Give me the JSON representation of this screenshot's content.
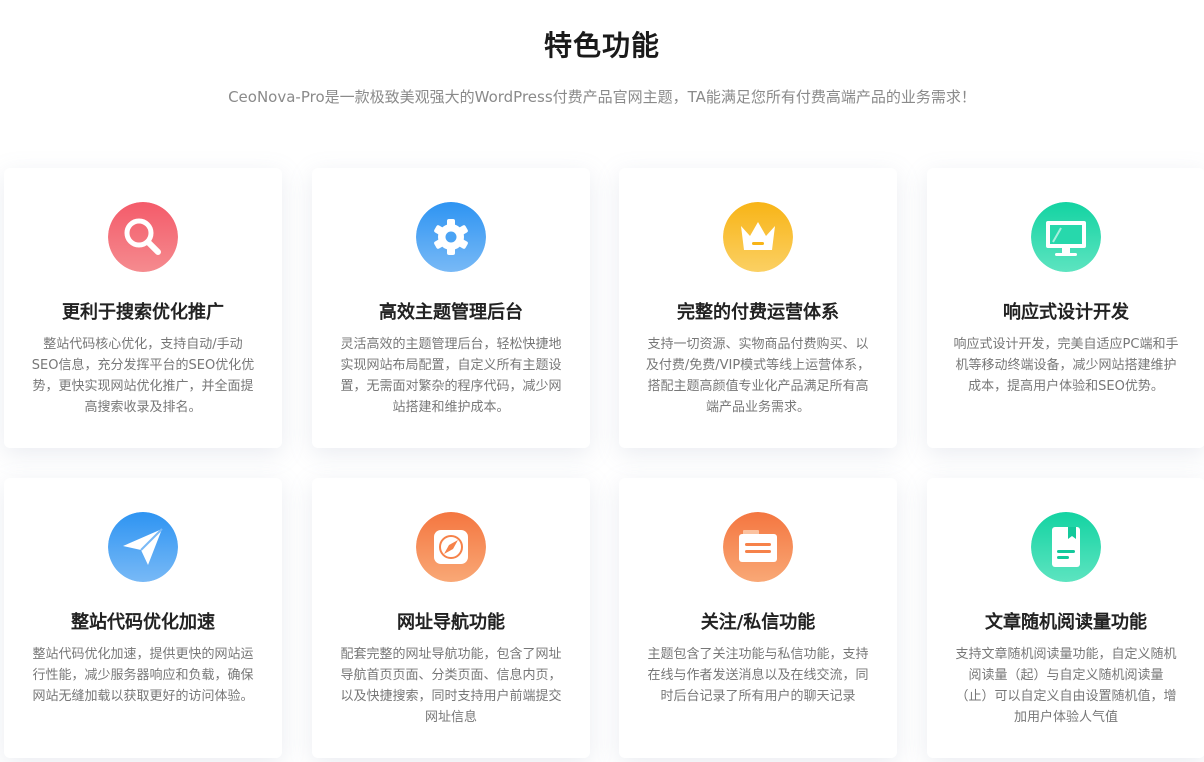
{
  "section": {
    "title": "特色功能",
    "subtitle": "CeoNova-Pro是一款极致美观强大的WordPress付费产品官网主题，TA能满足您所有付费高端产品的业务需求！"
  },
  "features": [
    {
      "title": "更利于搜索优化推广",
      "desc": "整站代码核心优化，支持自动/手动SEO信息，充分发挥平台的SEO优化优势，更快实现网站优化推广，并全面提高搜索收录及排名。",
      "icon": "search-icon",
      "color": "#f2626e"
    },
    {
      "title": "高效主题管理后台",
      "desc": "灵活高效的主题管理后台，轻松快捷地实现网站布局配置，自定义所有主题设置，无需面对繁杂的程序代码，减少网站搭建和维护成本。",
      "icon": "gear-icon",
      "color": "#3d9ef3"
    },
    {
      "title": "完整的付费运营体系",
      "desc": "支持一切资源、实物商品付费购买、以及付费/免费/VIP模式等线上运营体系，搭配主题高颜值专业化产品满足所有高端产品业务需求。",
      "icon": "crown-icon",
      "color": "#f7b71d"
    },
    {
      "title": "响应式设计开发",
      "desc": "响应式设计开发，完美自适应PC端和手机等移动终端设备，减少网站搭建维护成本，提高用户体验和SEO优势。",
      "icon": "monitor-icon",
      "color": "#1ed6a8"
    },
    {
      "title": "整站代码优化加速",
      "desc": "整站代码优化加速，提供更快的网站运行性能，减少服务器响应和负载，确保网站无缝加载以获取更好的访问体验。",
      "icon": "paper-plane-icon",
      "color": "#3d9ef3"
    },
    {
      "title": "网址导航功能",
      "desc": "配套完整的网址导航功能，包含了网址导航首页页面、分类页面、信息内页，以及快捷搜索，同时支持用户前端提交网址信息",
      "icon": "compass-icon",
      "color": "#f6824a"
    },
    {
      "title": "关注/私信功能",
      "desc": "主题包含了关注功能与私信功能，支持在线与作者发送消息以及在线交流，同时后台记录了所有用户的聊天记录",
      "icon": "message-icon",
      "color": "#f6824a"
    },
    {
      "title": "文章随机阅读量功能",
      "desc": "支持文章随机阅读量功能，自定义随机阅读量（起）与自定义随机阅读量（止）可以自定义自由设置随机值，增加用户体验人气值",
      "icon": "book-icon",
      "color": "#1ed6a8"
    }
  ]
}
